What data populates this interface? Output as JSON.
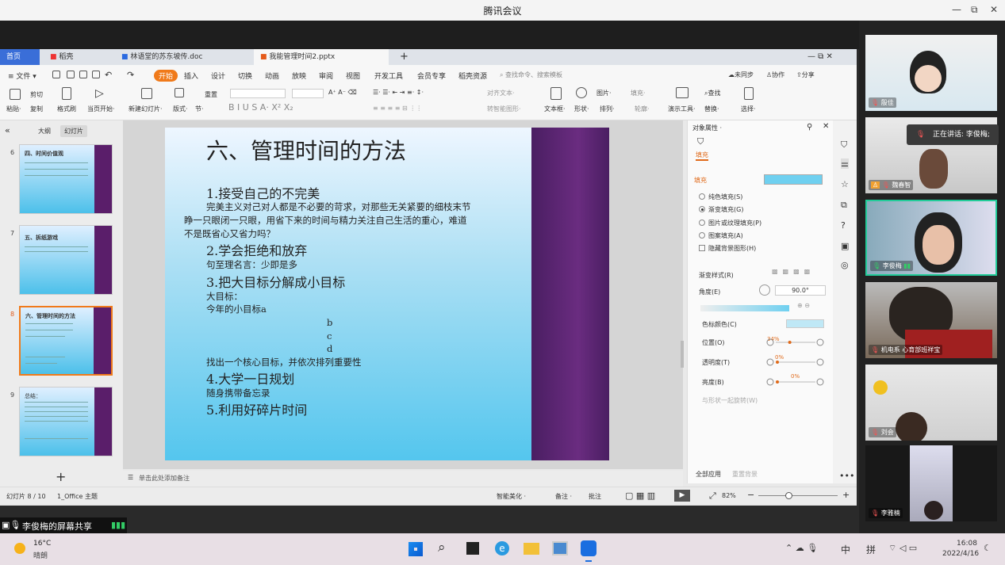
{
  "app": {
    "title": "腾讯会议",
    "controls": [
      "—",
      "⧉",
      "✕"
    ]
  },
  "wps": {
    "tabs": [
      "首页",
      "稻壳",
      "林语堂的苏东坡传.doc",
      "我能管理时间2.pptx"
    ],
    "menus": [
      "≡ 文件 ▾",
      "开始",
      "插入",
      "设计",
      "切换",
      "动画",
      "放映",
      "审阅",
      "视图",
      "开发工具",
      "会员专享",
      "稻壳资源"
    ],
    "search_placeholder": "查找命令、搜索模板",
    "top_right": [
      "未同步",
      "协作",
      "分享"
    ],
    "tools_row1": [
      "剪切",
      "重置",
      "查找"
    ],
    "tools_row2": [
      "粘贴·",
      "复制",
      "格式刷",
      "当页开始·",
      "新建幻灯片·",
      "版式·",
      "节·",
      "文本框·",
      "形状·",
      "排列·",
      "演示工具·",
      "替换·",
      "选择·"
    ],
    "tools_mid": [
      "图片·",
      "填充·",
      "轮廓·",
      "对齐文本·",
      "转智能图形·"
    ],
    "panel_tabs": [
      "大纲",
      "幻灯片"
    ],
    "thumbs": [
      {
        "num": "6",
        "title": "四、时间价值观"
      },
      {
        "num": "7",
        "title": "五、拆纸游戏"
      },
      {
        "num": "8",
        "title": "六、管理时间的方法"
      },
      {
        "num": "9",
        "title": "总结："
      }
    ],
    "slide": {
      "title": "六、管理时间的方法",
      "h1": "1.接受自己的不完美",
      "p1a": "完美主义对己对人都是不必要的苛求，对那些无关紧要的细枝末节",
      "p1b": "睁一只眼闭一只眼，用省下来的时间与精力关注自己生活的重心，难道",
      "p1c": "不是既省心又省力吗？",
      "h2": "2.学会拒绝和放弃",
      "p2": "句至理名言：少即是多",
      "h3": "3.把大目标分解成小目标",
      "p3a": "大目标：",
      "p3b": "今年的小目标a",
      "b": "b",
      "c": "c",
      "d": "d",
      "p3c": "找出一个核心目标，并依次排列重要性",
      "h4": "4.大学一日规划",
      "p4": "随身携带备忘录",
      "h5": "5.利用好碎片时间"
    },
    "props": {
      "header": "对象属性 ·",
      "tab": "填充",
      "fill_label": "填充",
      "options": [
        "纯色填充(S)",
        "渐变填充(G)",
        "图片或纹理填充(P)",
        "图案填充(A)"
      ],
      "selected_option": 1,
      "hide_bg": "隐藏背景图形(H)",
      "gradient_style": "渐变样式(R)",
      "angle_label": "角度(E)",
      "angle_value": "90.0°",
      "stop_color": "色标颜色(C)",
      "position_label": "位置(O)",
      "position_value": "34%",
      "transparency_label": "透明度(T)",
      "transparency_value": "0%",
      "brightness_label": "亮度(B)",
      "brightness_value": "0%",
      "rotate_with_shape": "与形状一起旋转(W)",
      "apply_all": "全部应用",
      "reset_bg": "重置背景",
      "accent": "#f07a1a",
      "fill_color": "#6fd0f0"
    },
    "notes_placeholder": "单击此处添加备注",
    "status_left": "幻灯片 8 / 10",
    "theme": "1_Office 主题",
    "status_right": [
      "智能美化 ·",
      "备注 ·",
      "批注"
    ],
    "zoom": "82%"
  },
  "sharer": "李俊梅的屏幕共享",
  "speaking": "正在讲话: 李俊梅;",
  "participants": [
    "殷佳",
    "魏春智",
    "李俊梅",
    "机电系 心育部班祥宝",
    "刘会",
    "李雅楠"
  ],
  "taskbar": {
    "weather_temp": "16°C",
    "weather_desc": "晴朗",
    "ime": [
      "中",
      "拼"
    ],
    "time": "16:08",
    "date": "2022/4/16"
  }
}
